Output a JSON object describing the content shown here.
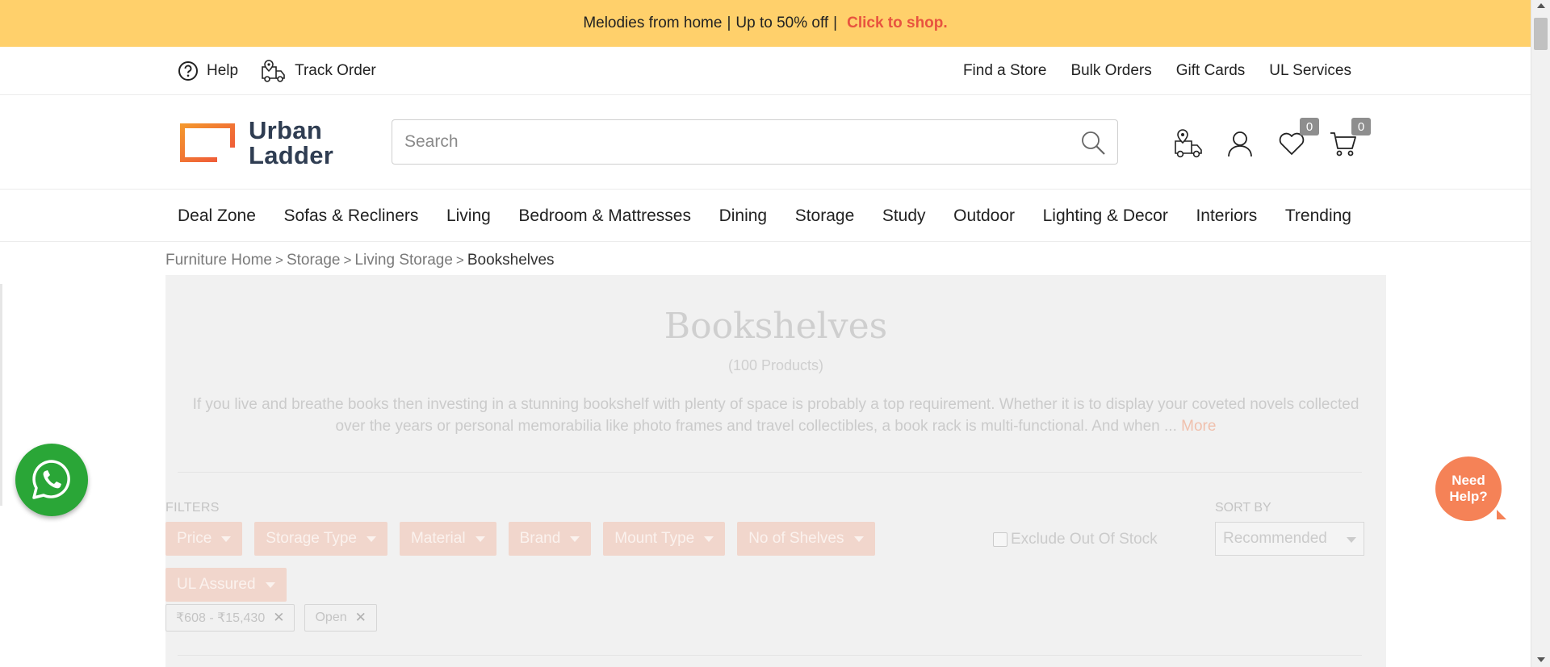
{
  "promo": {
    "text": "Melodies from home",
    "offer": "Up to 50% off",
    "separator": "|",
    "cta": "Click to shop."
  },
  "utility": {
    "left": [
      {
        "label": "Help",
        "icon": "help-circle-icon"
      },
      {
        "label": "Track Order",
        "icon": "delivery-truck-icon"
      }
    ],
    "right": [
      "Find a Store",
      "Bulk Orders",
      "Gift Cards",
      "UL Services"
    ]
  },
  "header": {
    "logo_line1": "Urban",
    "logo_line2": "Ladder",
    "search_placeholder": "Search",
    "wishlist_count": "0",
    "cart_count": "0"
  },
  "nav": [
    "Deal Zone",
    "Sofas & Recliners",
    "Living",
    "Bedroom & Mattresses",
    "Dining",
    "Storage",
    "Study",
    "Outdoor",
    "Lighting & Decor",
    "Interiors",
    "Trending"
  ],
  "breadcrumb": {
    "items": [
      "Furniture Home",
      "Storage",
      "Living Storage"
    ],
    "current": "Bookshelves",
    "separator": ">"
  },
  "category": {
    "title": "Bookshelves",
    "count": "(100 Products)",
    "description": "If you live and breathe books then investing in a stunning bookshelf with plenty of space is probably a top requirement. Whether it is to display your coveted novels collected over the years or personal memorabilia like photo frames and travel collectibles, a book rack is multi-functional. And when ... ",
    "more": "More"
  },
  "filters": {
    "label": "FILTERS",
    "items": [
      "Price",
      "Storage Type",
      "Material",
      "Brand",
      "Mount Type",
      "No of Shelves",
      "UL Assured"
    ],
    "exclude_oos": "Exclude Out Of Stock",
    "applied": [
      {
        "label": "₹608 - ₹15,430"
      },
      {
        "label": "Open"
      }
    ],
    "remove_symbol": "✕"
  },
  "sort": {
    "label": "SORT BY",
    "selected": "Recommended"
  },
  "widgets": {
    "need_help_line1": "Need",
    "need_help_line2": "Help?"
  },
  "colors": {
    "promo_bg": "#ffd06b",
    "cta": "#e8533f",
    "logo_text": "#2f3d52",
    "logo_orange": "#f1832e",
    "whatsapp": "#2aa637",
    "need_help": "#f58257"
  }
}
